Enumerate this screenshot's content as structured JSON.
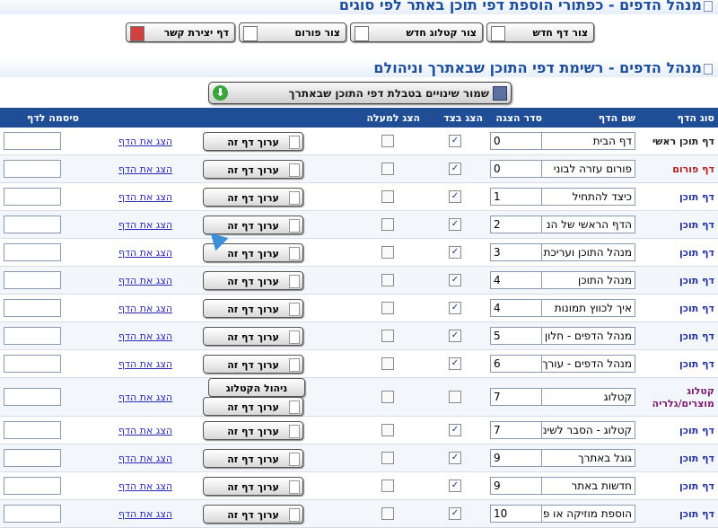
{
  "top_section": {
    "title": "מנהל הדפים - כפתורי הוספת דפי תוכן באתר לפי סוגים"
  },
  "add_buttons": [
    {
      "label": "צור דף חדש",
      "name": "create-page-button"
    },
    {
      "label": "צור קטלוג חדש",
      "name": "create-catalog-button"
    },
    {
      "label": "צור פורום",
      "name": "create-forum-button"
    },
    {
      "label": "דף יצירת קשר",
      "name": "contact-page-button"
    }
  ],
  "list_section": {
    "title": "מנהל הדפים - רשימת דפי התוכן שבאתרך וניהולם"
  },
  "save_button": {
    "label": "שמור שינויים בטבלת דפי התוכן שבאתרך"
  },
  "table": {
    "headers": {
      "type": "סוג הדף",
      "name": "שם הדף",
      "order": "סדר הצגה",
      "show_side": "הצג בצד",
      "show_top": "הצג למעלה",
      "edit": "",
      "show": "",
      "password": "סיסמה לדף"
    },
    "edit_label": "ערוך דף זה",
    "catalog_label": "ניהול הקטלוג",
    "show_label": "הצג את הדף",
    "rows": [
      {
        "type": "דף תוכן ראשי",
        "kind": "main",
        "name": "דף הבית",
        "order": "0",
        "side": "✓",
        "top": ""
      },
      {
        "type": "דף פורום",
        "kind": "forum",
        "name": "פורום עזרה לבוני",
        "order": "0",
        "side": "✓",
        "top": ""
      },
      {
        "type": "דף תוכן",
        "kind": "content",
        "name": "כיצד להתחיל",
        "order": "1",
        "side": "✓",
        "top": ""
      },
      {
        "type": "דף תוכן",
        "kind": "content",
        "name": "הדף הראשי של הנ",
        "order": "2",
        "side": "✓",
        "top": ""
      },
      {
        "type": "דף תוכן",
        "kind": "content",
        "name": "מנהל התוכן ועריכת",
        "order": "3",
        "side": "✓",
        "top": ""
      },
      {
        "type": "דף תוכן",
        "kind": "content",
        "name": "מנהל התוכן",
        "order": "4",
        "side": "✓",
        "top": ""
      },
      {
        "type": "דף תוכן",
        "kind": "content",
        "name": "איך לכווץ תמונות",
        "order": "4",
        "side": "✓",
        "top": ""
      },
      {
        "type": "דף תוכן",
        "kind": "content",
        "name": "מנהל הדפים - חלון",
        "order": "5",
        "side": "✓",
        "top": ""
      },
      {
        "type": "דף תוכן",
        "kind": "content",
        "name": "מנהל הדפים - עורך",
        "order": "6",
        "side": "✓",
        "top": ""
      },
      {
        "type": "קטלוג מוצרים/גלריה",
        "kind": "catalog",
        "name": "קטלוג",
        "order": "7",
        "side": "",
        "top": ""
      },
      {
        "type": "דף תוכן",
        "kind": "content",
        "name": "קטלוג - הסבר לשינ",
        "order": "7",
        "side": "✓",
        "top": ""
      },
      {
        "type": "דף תוכן",
        "kind": "content",
        "name": "גוגל באתרך",
        "order": "9",
        "side": "✓",
        "top": ""
      },
      {
        "type": "דף תוכן",
        "kind": "content",
        "name": "חדשות באתר",
        "order": "9",
        "side": "✓",
        "top": ""
      },
      {
        "type": "דף תוכן",
        "kind": "content",
        "name": "הוספת מוזיקה או פ",
        "order": "10",
        "side": "✓",
        "top": ""
      }
    ]
  }
}
